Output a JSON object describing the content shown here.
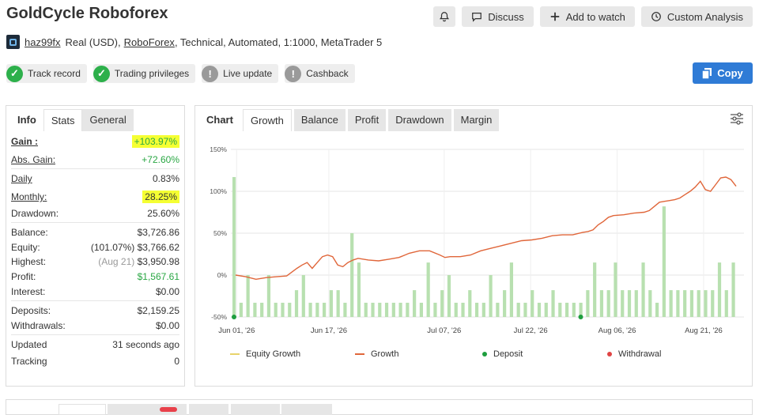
{
  "title": "GoldCycle Roboforex",
  "top_buttons": {
    "discuss": "Discuss",
    "add_to_watch": "Add to watch",
    "custom_analysis": "Custom Analysis"
  },
  "subline": {
    "username": "haz99fx",
    "text1": "Real (USD),",
    "broker": "RoboForex",
    "text2": ", Technical, Automated, 1:1000, MetaTrader 5"
  },
  "badges": [
    {
      "label": "Track record",
      "status": "ok"
    },
    {
      "label": "Trading privileges",
      "status": "ok"
    },
    {
      "label": "Live update",
      "status": "warn"
    },
    {
      "label": "Cashback",
      "status": "warn"
    }
  ],
  "copy_label": "Copy",
  "left_tabs": [
    "Info",
    "Stats",
    "General"
  ],
  "stats": {
    "gain": {
      "label": "Gain :",
      "value": "+103.97%"
    },
    "abs_gain": {
      "label": "Abs. Gain:",
      "value": "+72.60%"
    },
    "daily": {
      "label": "Daily",
      "value": "0.83%"
    },
    "monthly": {
      "label": "Monthly:",
      "value": "28.25%"
    },
    "drawdown": {
      "label": "Drawdown:",
      "value": "25.60%"
    },
    "balance": {
      "label": "Balance:",
      "value": "$3,726.86"
    },
    "equity": {
      "label": "Equity:",
      "prefix": "(101.07%)",
      "value": "$3,766.62"
    },
    "highest": {
      "label": "Highest:",
      "prefix": "(Aug 21)",
      "value": "$3,950.98"
    },
    "profit": {
      "label": "Profit:",
      "value": "$1,567.61"
    },
    "interest": {
      "label": "Interest:",
      "value": "$0.00"
    },
    "deposits": {
      "label": "Deposits:",
      "value": "$2,159.25"
    },
    "withdrawals": {
      "label": "Withdrawals:",
      "value": "$0.00"
    },
    "updated": {
      "label": "Updated",
      "value": "31 seconds ago"
    },
    "tracking": {
      "label": "Tracking",
      "value": "0"
    }
  },
  "chart_tabs": [
    "Chart",
    "Growth",
    "Balance",
    "Profit",
    "Drawdown",
    "Margin"
  ],
  "colors": {
    "growth_line": "#e0663a",
    "equity_line": "#e8d36b",
    "bars": "#b8e0b0",
    "deposit": "#1e9e3e",
    "withdrawal": "#e04444",
    "accent": "#2f7bd6",
    "highlight": "#f5ff33"
  },
  "chart_data": {
    "type": "line",
    "ylim": [
      -50,
      150
    ],
    "y_ticks": [
      "150%",
      "100%",
      "50%",
      "0%",
      "-50%"
    ],
    "y_tick_values": [
      150,
      100,
      50,
      0,
      -50
    ],
    "x_ticks": [
      "Jun 01, '26",
      "Jun 17, '26",
      "Jul 07, '26",
      "Jul 22, '26",
      "Aug 06, '26",
      "Aug 21, '26"
    ],
    "x_tick_positions": [
      1,
      17,
      37,
      52,
      67,
      82
    ],
    "x_range": [
      0,
      89
    ],
    "legend": [
      "Equity Growth",
      "Growth",
      "Deposit",
      "Withdrawal"
    ],
    "growth": [
      [
        0,
        0
      ],
      [
        2,
        -2
      ],
      [
        4,
        -5
      ],
      [
        6,
        -3
      ],
      [
        8,
        -2
      ],
      [
        10,
        -1
      ],
      [
        12,
        8
      ],
      [
        13,
        12
      ],
      [
        14,
        15
      ],
      [
        15,
        8
      ],
      [
        16,
        15
      ],
      [
        17,
        22
      ],
      [
        18,
        24
      ],
      [
        19,
        22
      ],
      [
        20,
        12
      ],
      [
        21,
        10
      ],
      [
        22,
        15
      ],
      [
        23,
        18
      ],
      [
        24,
        20
      ],
      [
        26,
        18
      ],
      [
        28,
        17
      ],
      [
        30,
        19
      ],
      [
        32,
        21
      ],
      [
        34,
        26
      ],
      [
        36,
        29
      ],
      [
        38,
        29
      ],
      [
        40,
        24
      ],
      [
        41,
        21
      ],
      [
        42,
        22
      ],
      [
        44,
        22
      ],
      [
        46,
        24
      ],
      [
        48,
        29
      ],
      [
        50,
        32
      ],
      [
        52,
        35
      ],
      [
        54,
        38
      ],
      [
        56,
        41
      ],
      [
        58,
        42
      ],
      [
        60,
        44
      ],
      [
        62,
        47
      ],
      [
        64,
        48
      ],
      [
        66,
        48
      ],
      [
        68,
        51
      ],
      [
        69,
        52
      ],
      [
        70,
        54
      ],
      [
        71,
        60
      ],
      [
        72,
        64
      ],
      [
        73,
        69
      ],
      [
        74,
        71
      ],
      [
        76,
        72
      ],
      [
        78,
        74
      ],
      [
        80,
        75
      ],
      [
        81,
        77
      ],
      [
        82,
        82
      ],
      [
        83,
        87
      ],
      [
        84,
        88
      ],
      [
        85,
        89
      ],
      [
        86,
        90
      ],
      [
        87,
        92
      ],
      [
        88,
        96
      ],
      [
        89,
        100
      ],
      [
        90,
        105
      ],
      [
        91,
        112
      ],
      [
        92,
        102
      ],
      [
        93,
        100
      ],
      [
        94,
        108
      ],
      [
        95,
        116
      ],
      [
        96,
        117
      ],
      [
        97,
        114
      ],
      [
        98,
        106
      ]
    ],
    "bars": [
      [
        0,
        117
      ],
      [
        1,
        -33
      ],
      [
        2,
        0
      ],
      [
        3,
        -33
      ],
      [
        4,
        -33
      ],
      [
        5,
        0
      ],
      [
        6,
        -33
      ],
      [
        7,
        -33
      ],
      [
        8,
        -33
      ],
      [
        9,
        -18
      ],
      [
        10,
        0
      ],
      [
        11,
        -33
      ],
      [
        12,
        -33
      ],
      [
        13,
        -33
      ],
      [
        14,
        -18
      ],
      [
        15,
        -18
      ],
      [
        16,
        -33
      ],
      [
        17,
        50
      ],
      [
        18,
        15
      ],
      [
        19,
        -33
      ],
      [
        20,
        -33
      ],
      [
        21,
        -33
      ],
      [
        22,
        -33
      ],
      [
        23,
        -33
      ],
      [
        24,
        -33
      ],
      [
        25,
        -33
      ],
      [
        26,
        -18
      ],
      [
        27,
        -33
      ],
      [
        28,
        15
      ],
      [
        29,
        -33
      ],
      [
        30,
        -18
      ],
      [
        31,
        0
      ],
      [
        32,
        -33
      ],
      [
        33,
        -33
      ],
      [
        34,
        -18
      ],
      [
        35,
        -33
      ],
      [
        36,
        -33
      ],
      [
        37,
        0
      ],
      [
        38,
        -33
      ],
      [
        39,
        -18
      ],
      [
        40,
        15
      ],
      [
        41,
        -33
      ],
      [
        42,
        -33
      ],
      [
        43,
        -18
      ],
      [
        44,
        -33
      ],
      [
        45,
        -33
      ],
      [
        46,
        -18
      ],
      [
        47,
        -33
      ],
      [
        48,
        -33
      ],
      [
        49,
        -33
      ],
      [
        50,
        -33
      ],
      [
        51,
        -18
      ],
      [
        52,
        15
      ],
      [
        53,
        -18
      ],
      [
        54,
        -18
      ],
      [
        55,
        15
      ],
      [
        56,
        -18
      ],
      [
        57,
        -18
      ],
      [
        58,
        -18
      ],
      [
        59,
        15
      ],
      [
        60,
        -18
      ],
      [
        61,
        -33
      ],
      [
        62,
        82
      ],
      [
        63,
        -18
      ],
      [
        64,
        -18
      ],
      [
        65,
        -18
      ],
      [
        66,
        -18
      ],
      [
        67,
        -18
      ],
      [
        68,
        -18
      ],
      [
        69,
        -18
      ],
      [
        70,
        15
      ],
      [
        71,
        -18
      ],
      [
        72,
        15
      ]
    ],
    "deposits_x": [
      0,
      50
    ]
  }
}
